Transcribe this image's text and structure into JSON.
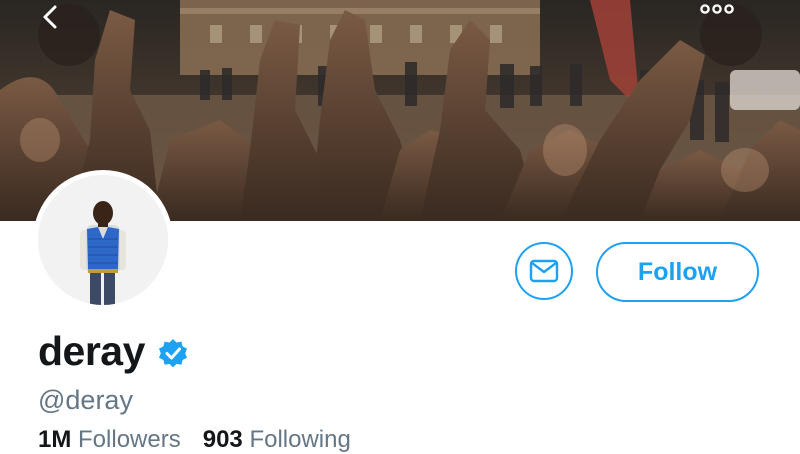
{
  "profile": {
    "display_name": "deray",
    "handle": "@deray",
    "verified": true,
    "avatar_alt": "profile photo"
  },
  "stats": {
    "followers_count": "1M",
    "followers_label": "Followers",
    "following_count": "903",
    "following_label": "Following"
  },
  "actions": {
    "follow_label": "Follow",
    "message_icon": "mail-icon",
    "back_icon": "chevron-left-icon",
    "more_icon": "more-horizontal-icon"
  },
  "colors": {
    "accent": "#1da1f2",
    "text_primary": "#14171a",
    "text_secondary": "#657786"
  }
}
